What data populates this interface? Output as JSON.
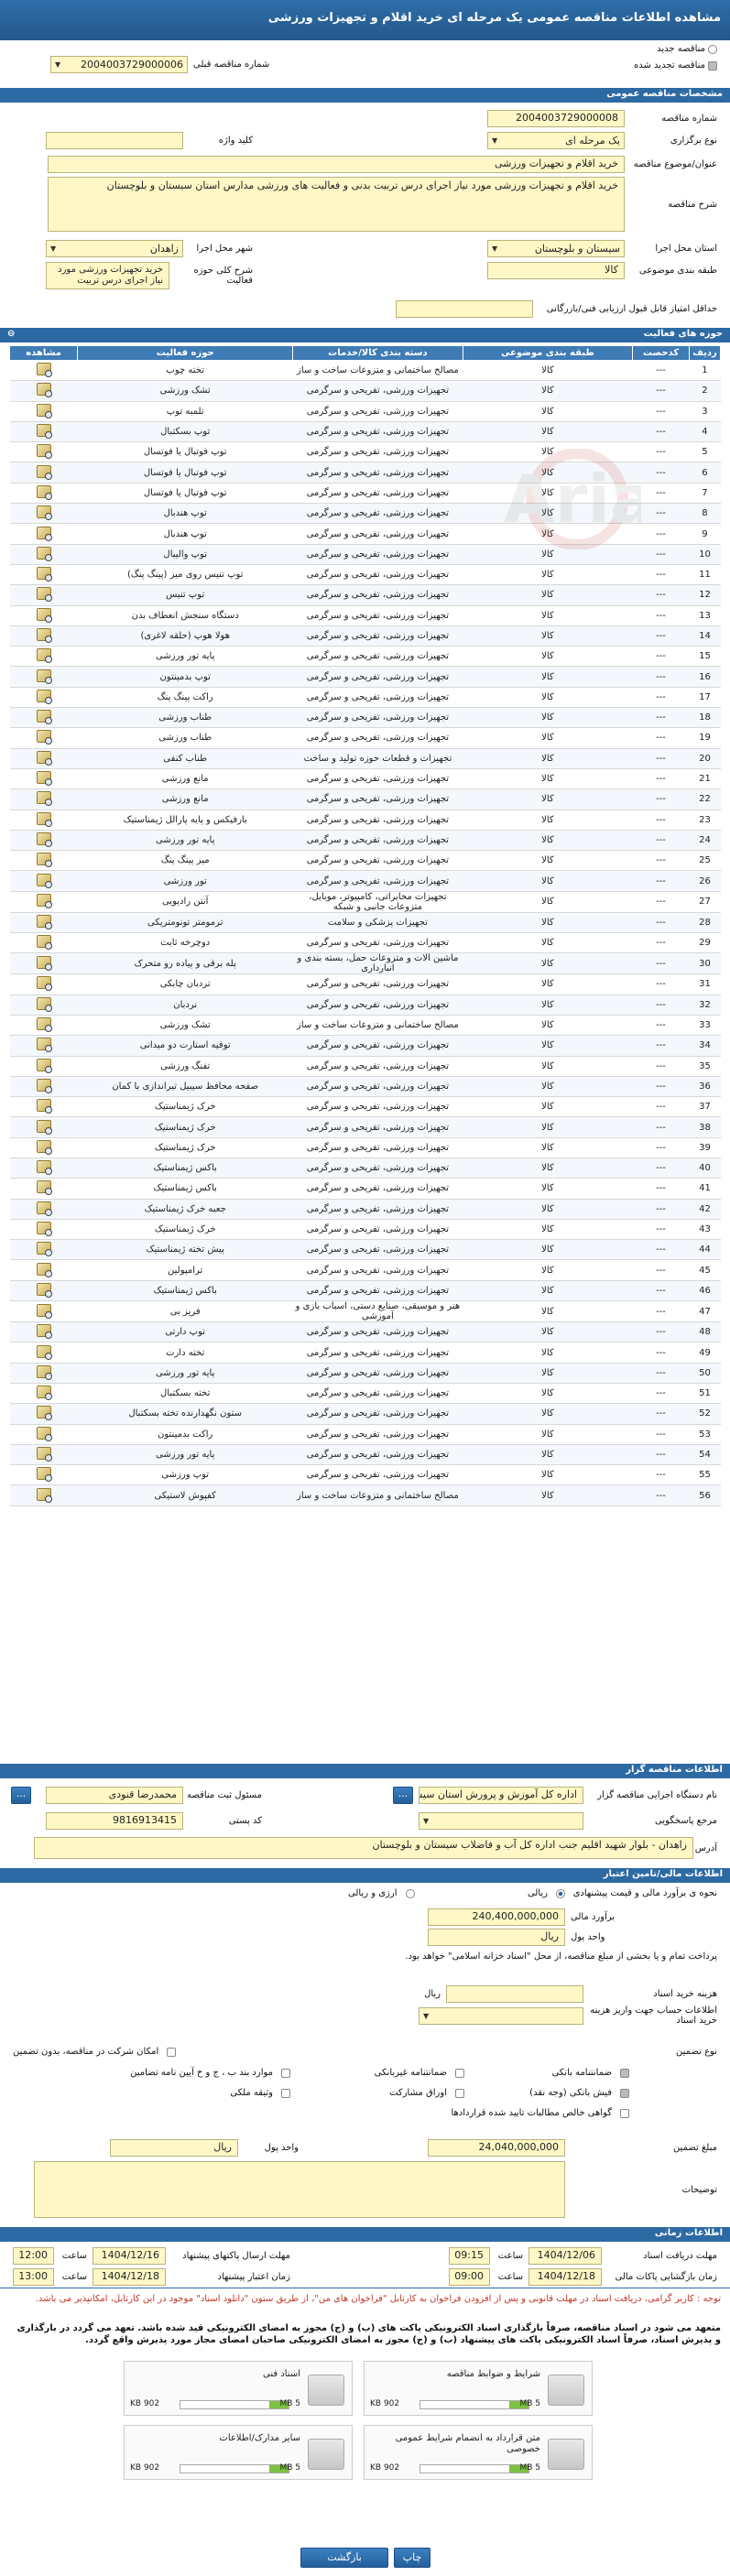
{
  "header": {
    "title": "مشاهده اطلاعات مناقصه عمومی یک مرحله ای خرید اقلام و تجهیزات ورزشی"
  },
  "top": {
    "new_label": "مناقصه جدید",
    "renew_label": "مناقصه تجدید شده",
    "prev_label": "شماره مناقصه قبلی",
    "prev_value": "2004003729000006"
  },
  "sec_specs": "مشخصات مناقصه عمومی",
  "specs": {
    "number_label": "شماره مناقصه",
    "number": "2004003729000008",
    "type_label": "نوع برگزاری",
    "type": "یک مرحله ای",
    "keyword_label": "کلید واژه",
    "keyword": "",
    "title_label": "عنوان/موضوع مناقصه",
    "title": "خرید اقلام و تجهیزات ورزشی",
    "desc_label": "شرح مناقصه",
    "desc": "خرید اقلام و تجهیزات ورزشی مورد نیاز اجرای درس تربیت بدنی و فعالیت های ورزشی مدارس استان سیستان و بلوچستان",
    "province_label": "استان محل اجرا",
    "province": "سیستان و بلوچستان",
    "city_label": "شهر محل اجرا",
    "city": "زاهدان",
    "category_label": "طبقه بندی موضوعی",
    "category": "کالا",
    "scope_label": "شرح کلی حوزه فعالیت",
    "scope": "خرید تجهیزات ورزشی مورد نیاز اجرای درس تربیت",
    "min_score_label": "حداقل امتیاز قابل قبول ارزیابی فنی/بازرگانی",
    "min_score": ""
  },
  "sec_items": "حوزه های فعالیت",
  "table": {
    "headers": [
      "ردیف",
      "کدحصت",
      "طبقه بندی موضوعی",
      "دسته بندی کالا/خدمات",
      "حوزه فعالیت",
      "مشاهده"
    ],
    "rows": [
      [
        "1",
        "---",
        "کالا",
        "مصالح ساختمانی و متزوعات ساخت و ساز",
        "تخته چوب"
      ],
      [
        "2",
        "---",
        "کالا",
        "تجهیزات ورزشی، تفریحی و سرگرمی",
        "تشک ورزشی"
      ],
      [
        "3",
        "---",
        "کالا",
        "تجهیزات ورزشی، تفریحی و سرگرمی",
        "تلمبه توپ"
      ],
      [
        "4",
        "---",
        "کالا",
        "تجهیزات ورزشی، تفریحی و سرگرمی",
        "توپ بسکتبال"
      ],
      [
        "5",
        "---",
        "کالا",
        "تجهیزات ورزشی، تفریحی و سرگرمی",
        "توپ فوتبال یا فوتسال"
      ],
      [
        "6",
        "---",
        "کالا",
        "تجهیزات ورزشی، تفریحی و سرگرمی",
        "توپ فوتبال یا فوتسال"
      ],
      [
        "7",
        "---",
        "کالا",
        "تجهیزات ورزشی، تفریحی و سرگرمی",
        "توپ فوتبال یا فوتسال"
      ],
      [
        "8",
        "---",
        "کالا",
        "تجهیزات ورزشی، تفریحی و سرگرمی",
        "توپ هندبال"
      ],
      [
        "9",
        "---",
        "کالا",
        "تجهیزات ورزشی، تفریحی و سرگرمی",
        "توپ هندبال"
      ],
      [
        "10",
        "---",
        "کالا",
        "تجهیزات ورزشی، تفریحی و سرگرمی",
        "توپ والیبال"
      ],
      [
        "11",
        "---",
        "کالا",
        "تجهیزات ورزشی، تفریحی و سرگرمی",
        "توپ تنیس روی میز (پینگ پنگ)"
      ],
      [
        "12",
        "---",
        "کالا",
        "تجهیزات ورزشی، تفریحی و سرگرمی",
        "توپ تنیس"
      ],
      [
        "13",
        "---",
        "کالا",
        "تجهیزات ورزشی، تفریحی و سرگرمی",
        "دستگاه سنجش انعطاف بدن"
      ],
      [
        "14",
        "---",
        "کالا",
        "تجهیزات ورزشی، تفریحی و سرگرمی",
        "هولا هوپ (حلقه لاغری)"
      ],
      [
        "15",
        "---",
        "کالا",
        "تجهیزات ورزشی، تفریحی و سرگرمی",
        "پایه تور ورزشی"
      ],
      [
        "16",
        "---",
        "کالا",
        "تجهیزات ورزشی، تفریحی و سرگرمی",
        "توپ بدمینتون"
      ],
      [
        "17",
        "---",
        "کالا",
        "تجهیزات ورزشی، تفریحی و سرگرمی",
        "راکت پینگ پنگ"
      ],
      [
        "18",
        "---",
        "کالا",
        "تجهیزات ورزشی، تفریحی و سرگرمی",
        "طناب ورزشی"
      ],
      [
        "19",
        "---",
        "کالا",
        "تجهیزات ورزشی، تفریحی و سرگرمی",
        "طناب ورزشی"
      ],
      [
        "20",
        "---",
        "کالا",
        "تجهیزات و قطعات حوزه تولید و ساخت",
        "طناب کنفی"
      ],
      [
        "21",
        "---",
        "کالا",
        "تجهیزات ورزشی، تفریحی و سرگرمی",
        "مانع ورزشی"
      ],
      [
        "22",
        "---",
        "کالا",
        "تجهیزات ورزشی، تفریحی و سرگرمی",
        "مانع ورزشی"
      ],
      [
        "23",
        "---",
        "کالا",
        "تجهیزات ورزشی، تفریحی و سرگرمی",
        "بارفیکس و پایه پارالل ژیمناستیک"
      ],
      [
        "24",
        "---",
        "کالا",
        "تجهیزات ورزشی، تفریحی و سرگرمی",
        "پایه تور ورزشی"
      ],
      [
        "25",
        "---",
        "کالا",
        "تجهیزات ورزشی، تفریحی و سرگرمی",
        "میز پینگ پنگ"
      ],
      [
        "26",
        "---",
        "کالا",
        "تجهیزات ورزشی، تفریحی و سرگرمی",
        "تور ورزشی"
      ],
      [
        "27",
        "---",
        "کالا",
        "تجهیزات مخابراتی، کامپیوتر، موبایل، متزوعات جانبی و شبکه",
        "آنتن رادیویی"
      ],
      [
        "28",
        "---",
        "کالا",
        "تجهیزات پزشکی و سلامت",
        "ترمومتر تونومتریکی"
      ],
      [
        "29",
        "---",
        "کالا",
        "تجهیزات ورزشی، تفریحی و سرگرمی",
        "دوچرخه ثابت"
      ],
      [
        "30",
        "---",
        "کالا",
        "ماشین آلات و متزوعات حمل، بسته بندی و انبارداری",
        "پله برقی و پیاده رو متحرک"
      ],
      [
        "31",
        "---",
        "کالا",
        "تجهیزات ورزشی، تفریحی و سرگرمی",
        "تردبان چابکی"
      ],
      [
        "32",
        "---",
        "کالا",
        "تجهیزات ورزشی، تفریحی و سرگرمی",
        "نردبان"
      ],
      [
        "33",
        "---",
        "کالا",
        "مصالح ساختمانی و متزوعات ساخت و ساز",
        "تشک ورزشی"
      ],
      [
        "34",
        "---",
        "کالا",
        "تجهیزات ورزشی، تفریحی و سرگرمی",
        "توقیه استارت دو میدانی"
      ],
      [
        "35",
        "---",
        "کالا",
        "تجهیزات ورزشی، تفریحی و سرگرمی",
        "تفنگ ورزشی"
      ],
      [
        "36",
        "---",
        "کالا",
        "تجهیزات ورزشی، تفریحی و سرگرمی",
        "صفحه محافظ سیبیل تیراندازی با کمان"
      ],
      [
        "37",
        "---",
        "کالا",
        "تجهیزات ورزشی، تفریحی و سرگرمی",
        "خرک ژیمناستیک"
      ],
      [
        "38",
        "---",
        "کالا",
        "تجهیزات ورزشی، تفریحی و سرگرمی",
        "خرک ژیمناستیک"
      ],
      [
        "39",
        "---",
        "کالا",
        "تجهیزات ورزشی، تفریحی و سرگرمی",
        "خرک ژیمناستیک"
      ],
      [
        "40",
        "---",
        "کالا",
        "تجهیزات ورزشی، تفریحی و سرگرمی",
        "باکس ژیمناستیک"
      ],
      [
        "41",
        "---",
        "کالا",
        "تجهیزات ورزشی، تفریحی و سرگرمی",
        "باکس ژیمناستیک"
      ],
      [
        "42",
        "---",
        "کالا",
        "تجهیزات ورزشی، تفریحی و سرگرمی",
        "جعبه خرک ژیمناستیک"
      ],
      [
        "43",
        "---",
        "کالا",
        "تجهیزات ورزشی، تفریحی و سرگرمی",
        "خرک ژیمناستیک"
      ],
      [
        "44",
        "---",
        "کالا",
        "تجهیزات ورزشی، تفریحی و سرگرمی",
        "پیش تخته ژیمناستیک"
      ],
      [
        "45",
        "---",
        "کالا",
        "تجهیزات ورزشی، تفریحی و سرگرمی",
        "ترامپولین"
      ],
      [
        "46",
        "---",
        "کالا",
        "تجهیزات ورزشی، تفریحی و سرگرمی",
        "باکس ژیمناستیک"
      ],
      [
        "47",
        "---",
        "کالا",
        "هنر و موسیقی، صنایع دستی، اسباب بازی و آموزشی",
        "فریز بی"
      ],
      [
        "48",
        "---",
        "کالا",
        "تجهیزات ورزشی، تفریحی و سرگرمی",
        "توپ دارتی"
      ],
      [
        "49",
        "---",
        "کالا",
        "تجهیزات ورزشی، تفریحی و سرگرمی",
        "تخته دارت"
      ],
      [
        "50",
        "---",
        "کالا",
        "تجهیزات ورزشی، تفریحی و سرگرمی",
        "پایه تور ورزشی"
      ],
      [
        "51",
        "---",
        "کالا",
        "تجهیزات ورزشی، تفریحی و سرگرمی",
        "تخته بسکتبال"
      ],
      [
        "52",
        "---",
        "کالا",
        "تجهیزات ورزشی، تفریحی و سرگرمی",
        "ستون نگهدارنده تخته بسکتبال"
      ],
      [
        "53",
        "---",
        "کالا",
        "تجهیزات ورزشی، تفریحی و سرگرمی",
        "راکت بدمینتون"
      ],
      [
        "54",
        "---",
        "کالا",
        "تجهیزات ورزشی، تفریحی و سرگرمی",
        "پایه تور ورزشی"
      ],
      [
        "55",
        "---",
        "کالا",
        "تجهیزات ورزشی، تفریحی و سرگرمی",
        "توپ ورزشی"
      ],
      [
        "56",
        "---",
        "کالا",
        "مصالح ساختمانی و متزوعات ساخت و ساز",
        "کفپوش لاستیکی"
      ]
    ]
  },
  "sec_org": "اطلاعات مناقصه گزار",
  "org": {
    "name_label": "نام دستگاه اجرایی مناقصه گزار",
    "name": "اداره کل آموزش و پرورش استان سیستان",
    "person_label": "مسئول ثبت مناقصه",
    "person": "محمدرضا قنودی",
    "ref_label": "مرجع پاسخگویی",
    "ref": "",
    "postal_label": "کد پستی",
    "postal": "9816913415",
    "address_label": "آدرس",
    "address": "زاهدان - بلوار شهید اقلیم جنب اداره کل آب و فاضلاب سیستان و بلوچستان",
    "btn": "..."
  },
  "sec_finance": "اطلاعات مالی/تامین اعتبار",
  "finance": {
    "estimate_type_label": "نحوه ی برآورد مالی و قیمت پیشنهادی",
    "rial_label": "ارزی و ریالی",
    "rial_only_label": "ریالی",
    "estimate_label": "برآورد مالی",
    "estimate": "240,400,000,000",
    "unit_label": "واحد پول",
    "unit": "ریال",
    "note": "پرداخت تمام و یا بخشی از مبلغ مناقصه، از محل \"اسناد خزانه اسلامی\" خواهد بود.",
    "fee_label": "هزینه خرید اسناد",
    "fee": "",
    "fee_unit": "ریال",
    "account_label": "اطلاعات حساب جهت واریز هزینه خرید اسناد",
    "account": "",
    "guarantee_type_label": "نوع تضمین",
    "guarantee_note": "امکان شرکت در مناقصه، بدون تضمین",
    "g1": "ضمانتنامه بانکی",
    "g2": "ضمانتنامه غیربانکی",
    "g3": "موارد بند ب ، ج و خ آیین نامه تضامین",
    "g4": "فیش بانکی (وجه نقد)",
    "g5": "اوراق مشارکت",
    "g6": "وثیقه ملکی",
    "g7": "گواهی خالص مطالبات تایید شده قراردادها",
    "amount_label": "مبلغ تضمین",
    "amount": "24,040,000,000",
    "amount_unit_label": "واحد پول",
    "amount_unit": "ریال",
    "notes_label": "توضیحات",
    "notes": ""
  },
  "sec_times": "اطلاعات زمانی",
  "times": {
    "doc_get_deadline_label": "مهلت دریافت اسناد",
    "doc_get_deadline_date": "1404/12/06",
    "time_label": "ساعت",
    "doc_get_deadline_time": "09:15",
    "send_deadline_label": "مهلت ارسال پاکتهای پیشنهاد",
    "send_deadline_date": "1404/12/16",
    "send_deadline_time": "12:00",
    "open_label": "زمان بازگشایی پاکات مالی",
    "open_date": "1404/12/18",
    "open_time": "09:00",
    "validity_label": "زمان اعتبار پیشنهاد",
    "validity_date": "1404/12/18",
    "validity_time": "13:00"
  },
  "notice1": "توجه : کاربر گرامی، دریافت اسناد در مهلت قانونی و پس از افزودن فراخوان به کارتابل \"فراخوان های من\"، از طریق ستون \"دانلود اسناد\" موجود در این کارتابل، امکانپذیر می باشد.",
  "notice2": "متعهد می شود در اسناد مناقصه، صرفاً بارگذاری اسناد الکترونیکی پاکت های (ب) و (ج) مجوز به امضای الکترونیکی قید شده باشد. تعهد می گردد در بارگذاری و پذیرش اسناد، صرفاً اسناد الکترونیکی پاکت های پیشنهاد (ب) و (ج) مجوز به امضای الکترونیکی صاحبان امضای مجاز مورد پذیرش واقع گردد.",
  "files": [
    {
      "name": "شرایط و ضوابط مناقصه",
      "size": "902 KB",
      "max": "5 MB",
      "pct": 18
    },
    {
      "name": "اسناد فنی",
      "size": "902 KB",
      "max": "5 MB",
      "pct": 18
    },
    {
      "name": "متن قرارداد به انضمام شرایط عمومی خصوصی",
      "size": "902 KB",
      "max": "5 MB",
      "pct": 18
    },
    {
      "name": "سایر مدارک/اطلاعات",
      "size": "902 KB",
      "max": "5 MB",
      "pct": 18
    }
  ],
  "footer": {
    "print": "چاپ",
    "back": "بازگشت"
  },
  "watermark": "AriaTender.net"
}
